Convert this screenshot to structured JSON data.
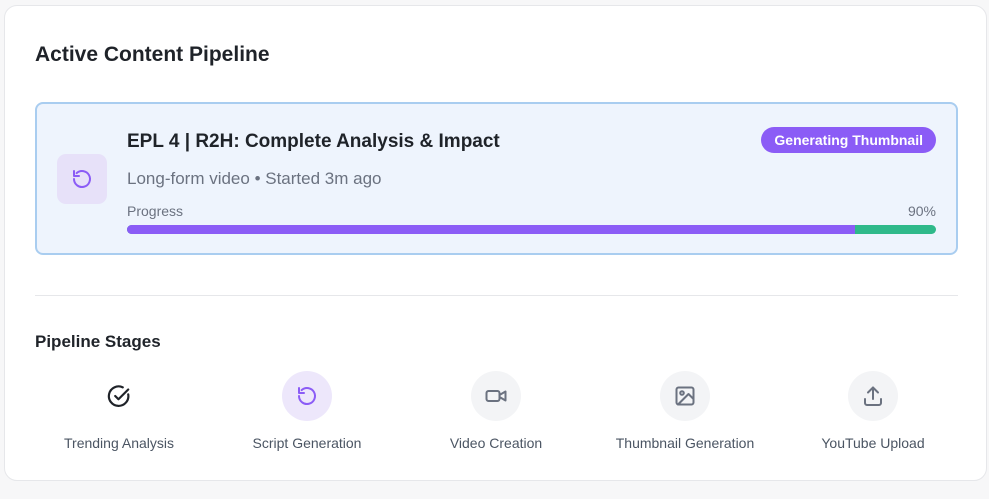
{
  "panel": {
    "title": "Active Content Pipeline"
  },
  "active_item": {
    "icon": "refresh-icon",
    "title": "EPL 4 | R2H: Complete Analysis & Impact",
    "meta": "Long-form video • Started 3m ago",
    "status_badge": "Generating Thumbnail",
    "progress_label": "Progress",
    "progress_text": "90%",
    "progress_fraction": 0.9
  },
  "stages_section": {
    "title": "Pipeline Stages",
    "stages": [
      {
        "label": "Trending Analysis",
        "icon": "check-circle-icon",
        "state": "done"
      },
      {
        "label": "Script Generation",
        "icon": "refresh-icon",
        "state": "active"
      },
      {
        "label": "Video Creation",
        "icon": "video-camera-icon",
        "state": "pending"
      },
      {
        "label": "Thumbnail Generation",
        "icon": "image-icon",
        "state": "pending"
      },
      {
        "label": "YouTube Upload",
        "icon": "upload-icon",
        "state": "pending"
      }
    ]
  },
  "colors": {
    "accent_purple": "#8b5cf6",
    "progress_remaining_green": "#2fb98a",
    "active_card_bg": "#eef4fd",
    "active_card_border": "#a9cdf0"
  }
}
